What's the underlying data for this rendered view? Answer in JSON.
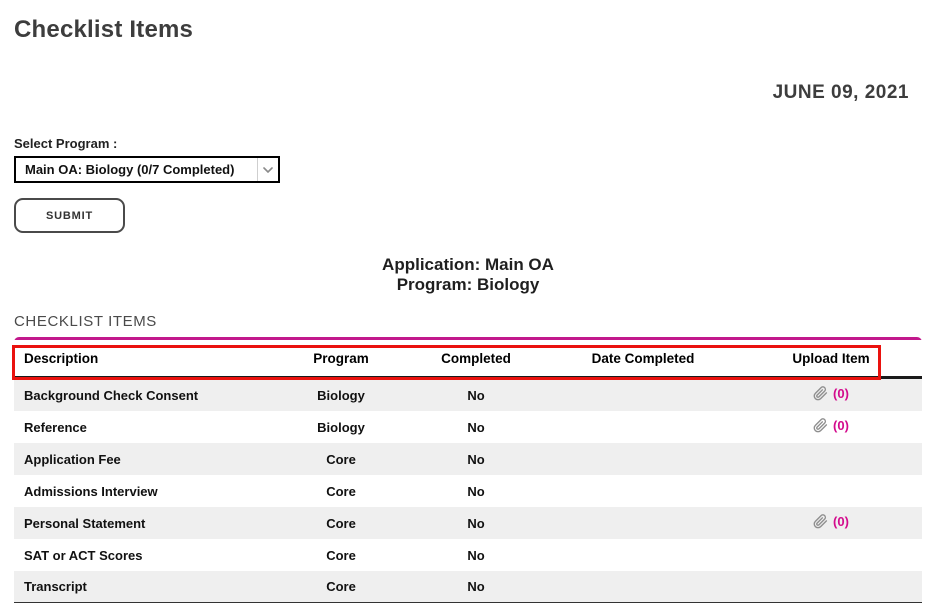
{
  "page": {
    "title": "Checklist Items",
    "date": "JUNE 09, 2021"
  },
  "program_form": {
    "label": "Select Program :",
    "selected_option": "Main OA: Biology (0/7 Completed)",
    "submit_label": "SUBMIT"
  },
  "application_info": {
    "application_line": "Application: Main OA",
    "program_line": "Program: Biology"
  },
  "section": {
    "heading": "CHECKLIST ITEMS"
  },
  "table": {
    "headers": [
      "Description",
      "Program",
      "Completed",
      "Date Completed",
      "Upload Item"
    ],
    "rows": [
      {
        "description": "Background Check Consent",
        "program": "Biology",
        "completed": "No",
        "date_completed": "",
        "has_upload": true,
        "upload_count": "(0)"
      },
      {
        "description": "Reference",
        "program": "Biology",
        "completed": "No",
        "date_completed": "",
        "has_upload": true,
        "upload_count": "(0)"
      },
      {
        "description": "Application Fee",
        "program": "Core",
        "completed": "No",
        "date_completed": "",
        "has_upload": false,
        "upload_count": ""
      },
      {
        "description": "Admissions Interview",
        "program": "Core",
        "completed": "No",
        "date_completed": "",
        "has_upload": false,
        "upload_count": ""
      },
      {
        "description": "Personal Statement",
        "program": "Core",
        "completed": "No",
        "date_completed": "",
        "has_upload": true,
        "upload_count": "(0)"
      },
      {
        "description": "SAT or ACT Scores",
        "program": "Core",
        "completed": "No",
        "date_completed": "",
        "has_upload": false,
        "upload_count": ""
      },
      {
        "description": "Transcript",
        "program": "Core",
        "completed": "No",
        "date_completed": "",
        "has_upload": false,
        "upload_count": ""
      }
    ]
  },
  "colors": {
    "accent_pink": "#d30b8d",
    "table_top_border": "#c2188c",
    "annotation_red": "#ea120e",
    "row_alt_background": "#efefef"
  },
  "icons": {
    "select_chevron": "chevron-down-icon",
    "upload": "paperclip-icon"
  }
}
